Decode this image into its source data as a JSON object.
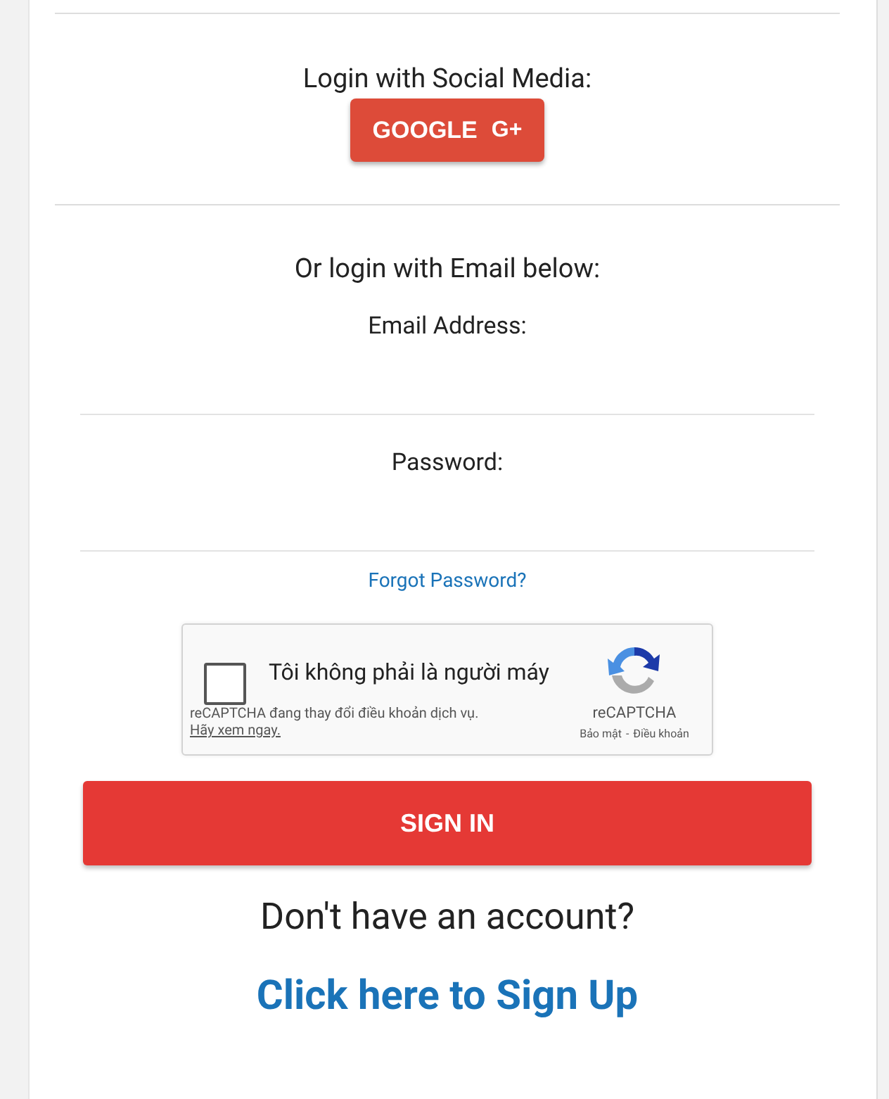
{
  "social": {
    "heading": "Login with Social Media:",
    "google_button": {
      "label": "GOOGLE",
      "icon_text": "G+"
    }
  },
  "email_section": {
    "heading": "Or login with Email below:",
    "fields": [
      {
        "label": "Email Address:"
      },
      {
        "label": "Password:"
      }
    ],
    "forgot_link": "Forgot Password?"
  },
  "recaptcha": {
    "checked": false,
    "label": "Tôi không phải là người máy",
    "notice": "reCAPTCHA đang thay đổi điều khoản dịch vụ.",
    "notice_link": "Hãy xem ngay.",
    "brand": "reCAPTCHA",
    "privacy": "Bảo mật",
    "separator": "-",
    "terms": "Điều khoản"
  },
  "sign_in_button": "SIGN IN",
  "signup": {
    "prompt": "Don't have an account?",
    "link": "Click here to Sign Up"
  }
}
